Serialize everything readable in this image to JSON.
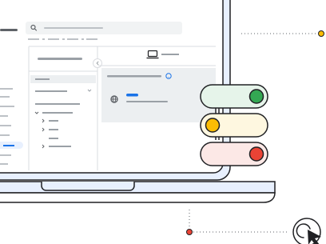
{
  "illustration": {
    "type": "laptop-admin-console-with-toggles",
    "palette": {
      "outline": "#202124",
      "screen_tint": "#e8f0fe",
      "panel_grey": "#eceff1",
      "placeholder_bar": "#9aa0a6",
      "accent_blue": "#1a73e8",
      "green": "#34a853",
      "green_track": "#e6f4ea",
      "yellow": "#fbbc04",
      "yellow_track": "#fef7e0",
      "red": "#ea4335",
      "red_track": "#fce8e6"
    },
    "toggles": [
      {
        "name": "green",
        "state": "on"
      },
      {
        "name": "yellow",
        "state": "off"
      },
      {
        "name": "red",
        "state": "on"
      }
    ],
    "icons": [
      "search-icon",
      "laptop-icon",
      "help-icon",
      "globe-icon",
      "cursor-click-icon"
    ]
  }
}
